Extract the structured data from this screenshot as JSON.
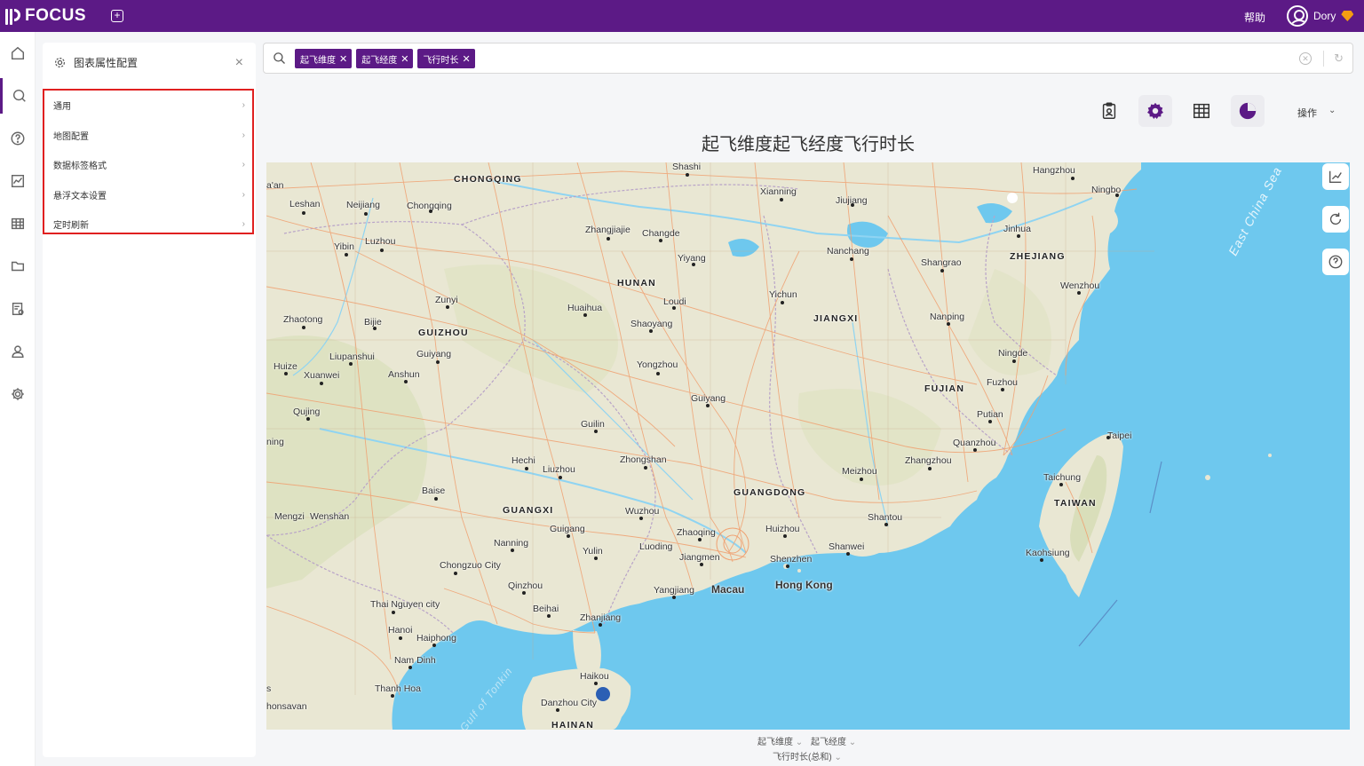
{
  "app": {
    "name": "FOCUS",
    "help": "帮助",
    "user": "Dory"
  },
  "config_panel": {
    "title": "图表属性配置",
    "items": [
      {
        "label": "通用"
      },
      {
        "label": "地图配置"
      },
      {
        "label": "数据标签格式"
      },
      {
        "label": "悬浮文本设置"
      },
      {
        "label": "定时刷新"
      }
    ]
  },
  "search": {
    "tokens": [
      "起飞维度",
      "起飞经度",
      "飞行时长"
    ]
  },
  "toolbar": {
    "ops_label": "操作"
  },
  "chart": {
    "title": "起飞维度起飞经度飞行时长"
  },
  "axis": {
    "lat": "起飞维度",
    "lng": "起飞经度",
    "value": "飞行时长(总和)"
  },
  "map": {
    "labels": {
      "chongqing": "CHONGQING",
      "hunan": "HUNAN",
      "guizhou": "GUIZHOU",
      "jiangxi": "JIANGXI",
      "zhejiang": "ZHEJIANG",
      "fujian": "FUJIAN",
      "guangdong": "GUANGDONG",
      "guangxi": "GUANGXI",
      "taiwan": "TAIWAN",
      "hainan": "HAINAN",
      "shashi": "Shashi",
      "hangzhou": "Hangzhou",
      "ningbo": "Ningbo",
      "xianning": "Xianning",
      "jiujiang": "Jiujiang",
      "leshan": "Leshan",
      "neijiang": "Neijiang",
      "chongqing_city": "Chongqing",
      "jinhua": "Jinhua",
      "zhangjiajie": "Zhangjiajie",
      "changde": "Changde",
      "nanchang": "Nanchang",
      "yibin": "Yibin",
      "luzhou": "Luzhou",
      "yiyang": "Yiyang",
      "shangrao": "Shangrao",
      "wenzhou": "Wenzhou",
      "zunyi": "Zunyi",
      "loudi": "Loudi",
      "yichun": "Yichun",
      "huaihua": "Huaihua",
      "zhaotong": "Zhaotong",
      "bijie": "Bijie",
      "shaoyang": "Shaoyang",
      "nanping": "Nanping",
      "liupanshui": "Liupanshui",
      "guiyang": "Guiyang",
      "ningde": "Ningde",
      "yongzhou": "Yongzhou",
      "huize": "Huize",
      "xuanwei": "Xuanwei",
      "anshun": "Anshun",
      "fuzhou": "Fuzhou",
      "qujing": "Qujing",
      "guiyang2": "Guiyang",
      "putian": "Putian",
      "guilin": "Guilin",
      "quanzhou": "Quanzhou",
      "taipei": "Taipei",
      "ning": "ning",
      "hechi": "Hechi",
      "zhongshan": "Zhongshan",
      "liuzhou": "Liuzhou",
      "zhangzhou": "Zhangzhou",
      "meizhou": "Meizhou",
      "taichung": "Taichung",
      "baise": "Baise",
      "mengzi": "Mengzi",
      "wenshan": "Wenshan",
      "wuzhou": "Wuzhou",
      "shantou": "Shantou",
      "guigang": "Guigang",
      "zhaoqing": "Zhaoqing",
      "huizhou": "Huizhou",
      "nanning": "Nanning",
      "shanwei": "Shanwei",
      "luoding": "Luoding",
      "kaohsiung": "Kaohsiung",
      "yulin": "Yulin",
      "jiangmen": "Jiangmen",
      "shenzhen": "Shenzhen",
      "chongzuo": "Chongzuo City",
      "hongkong": "Hong Kong",
      "qinzhou": "Qinzhou",
      "yangjiang": "Yangjiang",
      "macau": "Macau",
      "thainguyen": "Thai Nguyen city",
      "beihai": "Beihai",
      "zhanjiang": "Zhanjiang",
      "hanoi": "Hanoi",
      "haiphong": "Haiphong",
      "namdinh": "Nam Dinh",
      "haikou": "Haikou",
      "thanhhoa": "Thanh Hoa",
      "danzhou": "Danzhou City",
      "honsavan": "honsavan",
      "ean": "a'an",
      "s": "s",
      "east_china_sea": "East China Sea",
      "gulf_tonkin": "Gulf of Tonkin"
    }
  },
  "colors": {
    "brand": "#5c1a86",
    "sea": "#6ec8ee",
    "land": "#e9e7d3",
    "highlight": "#e02020",
    "point": "#2b5fb4"
  }
}
